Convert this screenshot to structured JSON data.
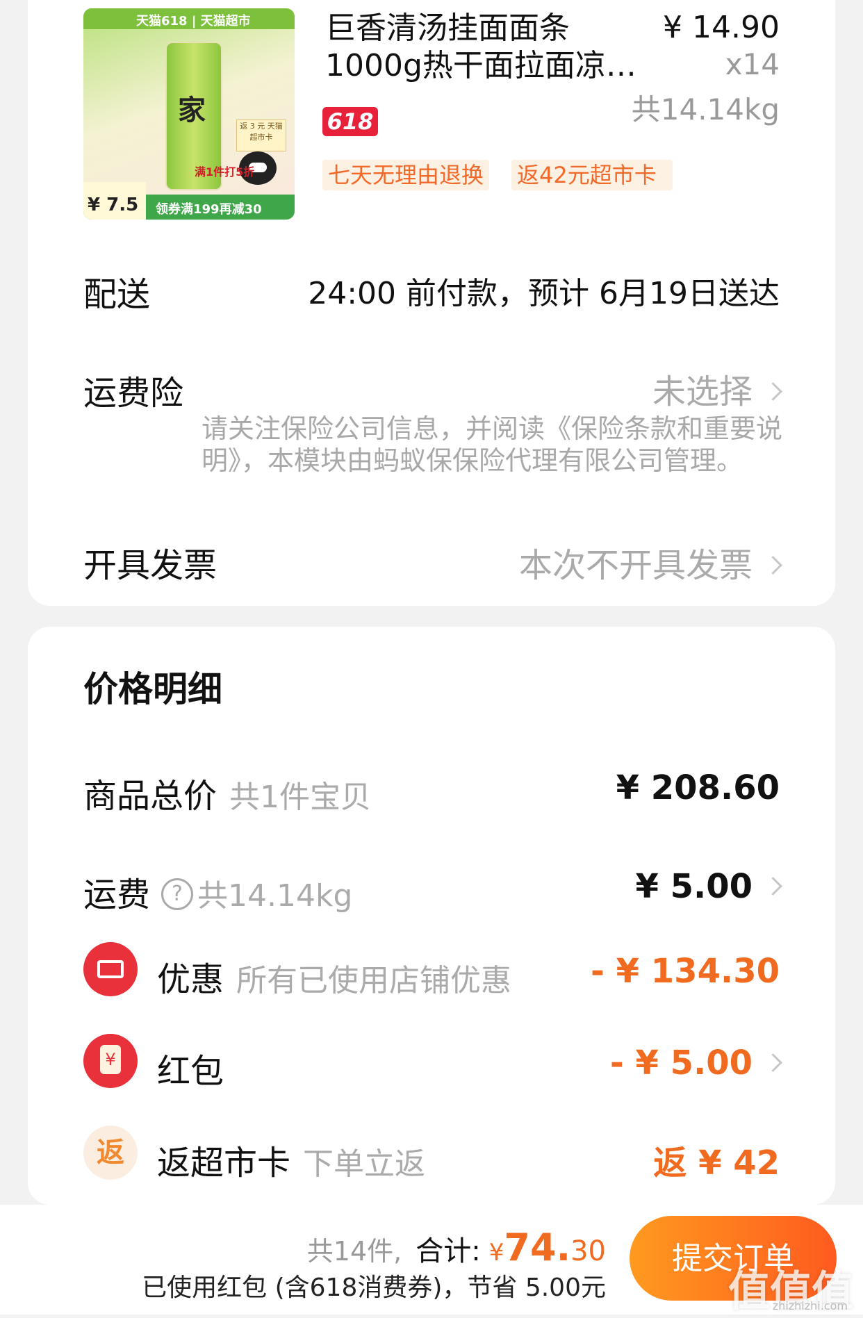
{
  "product": {
    "title_line1": "巨香清汤挂面面条",
    "title_line2": "1000g热干面拉面凉…",
    "unit_price": "¥ 14.90",
    "quantity": "x14",
    "weight": "共14.14kg",
    "badge": "618",
    "tags": [
      "七天无理由退换",
      "返42元超市卡"
    ],
    "image": {
      "top_banner": "天猫618 | 天猫超市",
      "bottle_char": "家",
      "promo_top": "满1件打5折",
      "promo_bottom": "领券满199再减30",
      "price_label": "¥ 7.5",
      "card_label": "返 3 元 天猫超市卡"
    }
  },
  "delivery": {
    "label": "配送",
    "info": "24:00 前付款，预计 6月19日送达"
  },
  "insurance": {
    "label": "运费险",
    "status": "未选择",
    "note": "请关注保险公司信息，并阅读《保险条款和重要说明》，本模块由蚂蚁保保险代理有限公司管理。"
  },
  "invoice": {
    "label": "开具发票",
    "status": "本次不开具发票"
  },
  "price_detail": {
    "title": "价格明细",
    "goods_total": {
      "label": "商品总价",
      "sub": "共1件宝贝",
      "value": "¥ 208.60"
    },
    "shipping": {
      "label": "运费",
      "help_icon": "?",
      "sub": "共14.14kg",
      "value": "¥ 5.00"
    },
    "discount": {
      "icon": "coupon-icon",
      "label": "优惠",
      "sub": "所有已使用店铺优惠",
      "value": "- ¥ 134.30"
    },
    "red_packet": {
      "icon": "red-packet-icon",
      "label": "红包",
      "value": "- ¥ 5.00"
    },
    "return_card": {
      "icon_text": "返",
      "label": "返超市卡",
      "sub": "下单立返",
      "value": "返 ¥ 42"
    }
  },
  "bottom_bar": {
    "count": "共14件,",
    "total_label": "合计:",
    "currency": "¥",
    "total_int": "74.",
    "total_dec": "30",
    "savings": "已使用红包 (含618消费券)，节省 5.00元",
    "submit_label": "提交订单"
  },
  "watermark": {
    "text": "值值值",
    "url": "zhizhizhi.com"
  },
  "colors": {
    "accent_orange": "#f06a1f",
    "red": "#e8313b",
    "button_start": "#ff9a1f",
    "button_end": "#ff5a1f"
  }
}
